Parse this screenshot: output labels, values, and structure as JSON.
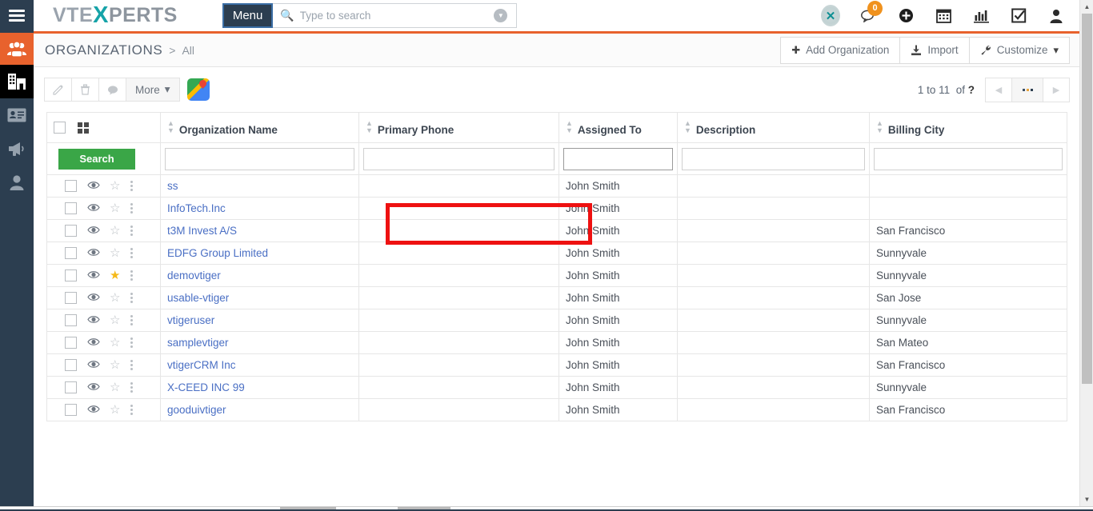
{
  "topbar": {
    "hamburger_icon": "hamburger-icon",
    "brand_part1": "VTE",
    "brand_x": "X",
    "brand_part2": "PERTS",
    "menu_label": "Menu",
    "search_placeholder": "Type to search",
    "search_value": "",
    "icons": [
      {
        "name": "xlogo-icon",
        "glyph": "✕",
        "badge": null
      },
      {
        "name": "chat-icon",
        "glyph": "🗩",
        "badge": "0"
      },
      {
        "name": "add-circle-icon",
        "glyph": "✚",
        "badge": null
      },
      {
        "name": "calendar-icon",
        "glyph": "📅",
        "badge": null
      },
      {
        "name": "analytics-icon",
        "glyph": "📊",
        "badge": null
      },
      {
        "name": "tasks-icon",
        "glyph": "☑",
        "badge": null
      },
      {
        "name": "user-icon",
        "glyph": "👤",
        "badge": null
      }
    ]
  },
  "sidebar": {
    "items": [
      {
        "name": "sidebar-item-contacts",
        "icon": "group-icon",
        "glyph": "👥",
        "state": "orange"
      },
      {
        "name": "sidebar-item-organizations",
        "icon": "building-icon",
        "glyph": "🏢",
        "state": "active"
      },
      {
        "name": "sidebar-item-leads",
        "icon": "contact-card-icon",
        "glyph": "📇",
        "state": ""
      },
      {
        "name": "sidebar-item-campaigns",
        "icon": "megaphone-icon",
        "glyph": "📢",
        "state": ""
      },
      {
        "name": "sidebar-item-users",
        "icon": "person-icon",
        "glyph": "👤",
        "state": ""
      }
    ],
    "expander_glyph": "❯"
  },
  "breadcrumb": {
    "title": "ORGANIZATIONS",
    "separator": ">",
    "current": "All"
  },
  "header_actions": {
    "add_label": "Add Organization",
    "add_icon": "plus-icon",
    "import_label": "Import",
    "import_icon": "import-icon",
    "customize_label": "Customize",
    "customize_icon": "wrench-icon",
    "customize_caret": "▾"
  },
  "toolbar": {
    "edit_icon": "pencil-icon",
    "delete_icon": "trash-icon",
    "comment_icon": "comment-icon",
    "more_label": "More",
    "more_caret": "▾",
    "maps_icon": "google-maps-icon"
  },
  "pagination": {
    "range_prefix": "1 to 11",
    "of_label": "of",
    "total": "?",
    "prev_icon": "chevron-left-icon",
    "next_icon": "chevron-right-icon",
    "mid_icon": "more-dots-icon"
  },
  "table": {
    "select_all_icon": "checkbox-icon",
    "grid_toggle_icon": "grid-view-icon",
    "search_button_label": "Search",
    "columns": [
      {
        "key": "actions",
        "label": "",
        "sortable": false
      },
      {
        "key": "name",
        "label": "Organization Name",
        "sortable": true
      },
      {
        "key": "phone",
        "label": "Primary Phone",
        "sortable": true
      },
      {
        "key": "assigned",
        "label": "Assigned To",
        "sortable": true
      },
      {
        "key": "desc",
        "label": "Description",
        "sortable": true
      },
      {
        "key": "city",
        "label": "Billing City",
        "sortable": true
      }
    ],
    "filters": {
      "name": "",
      "phone": "",
      "assigned": "",
      "desc": "",
      "city": ""
    },
    "rows": [
      {
        "name": "ss",
        "phone": "",
        "assigned": "John Smith",
        "desc": "",
        "city": "",
        "starred": false
      },
      {
        "name": "InfoTech.Inc",
        "phone": "",
        "assigned": "John Smith",
        "desc": "",
        "city": "",
        "starred": false
      },
      {
        "name": "t3M Invest A/S",
        "phone": "",
        "assigned": "John Smith",
        "desc": "",
        "city": "San Francisco",
        "starred": false
      },
      {
        "name": "EDFG Group Limited",
        "phone": "",
        "assigned": "John Smith",
        "desc": "",
        "city": "Sunnyvale",
        "starred": false
      },
      {
        "name": "demovtiger",
        "phone": "",
        "assigned": "John Smith",
        "desc": "",
        "city": "Sunnyvale",
        "starred": true
      },
      {
        "name": "usable-vtiger",
        "phone": "",
        "assigned": "John Smith",
        "desc": "",
        "city": "San Jose",
        "starred": false
      },
      {
        "name": "vtigeruser",
        "phone": "",
        "assigned": "John Smith",
        "desc": "",
        "city": "Sunnyvale",
        "starred": false
      },
      {
        "name": "samplevtiger",
        "phone": "",
        "assigned": "John Smith",
        "desc": "",
        "city": "San Mateo",
        "starred": false
      },
      {
        "name": "vtigerCRM Inc",
        "phone": "",
        "assigned": "John Smith",
        "desc": "",
        "city": "San Francisco",
        "starred": false
      },
      {
        "name": "X-CEED INC 99",
        "phone": "",
        "assigned": "John Smith",
        "desc": "",
        "city": "Sunnyvale",
        "starred": false
      },
      {
        "name": "gooduivtiger",
        "phone": "",
        "assigned": "John Smith",
        "desc": "",
        "city": "San Francisco",
        "starred": false
      }
    ],
    "row_icons": {
      "checkbox": "checkbox-icon",
      "preview": "eye-icon",
      "favorite": "star-icon",
      "menu": "kebab-menu-icon"
    }
  },
  "annotation": {
    "type": "highlight-box",
    "color": "#ee1111",
    "target": "primary-phone-column-rows-1-2"
  },
  "colors": {
    "accent_orange": "#e8622d",
    "sidebar_dark": "#2c3e50",
    "link_blue": "#4a6fc4",
    "search_green": "#3aa647",
    "badge_orange": "#f0921e",
    "brand_teal": "#16a3a8",
    "star_gold": "#f5b919"
  }
}
